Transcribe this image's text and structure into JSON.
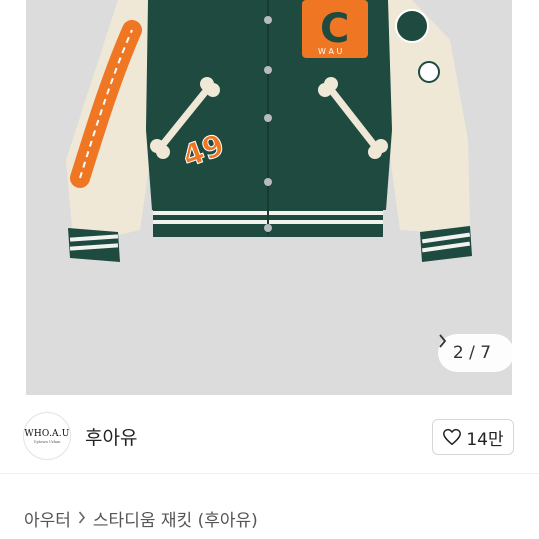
{
  "product_image": {
    "alt": "Varsity jacket photo",
    "counter_current": "2",
    "counter_separator": "/",
    "counter_total": "7",
    "patch_number": "49",
    "patch_letter": "C",
    "patch_sub": "W A U",
    "jacket_colors": {
      "body": "#1e4a3f",
      "sleeve": "#efe8d6",
      "accent": "#ef7622"
    }
  },
  "brand": {
    "logo_text": "WHO.A.U",
    "logo_subtext": "Uptown Urban",
    "name": "후아유"
  },
  "like_button": {
    "count": "14만"
  },
  "breadcrumb": {
    "category": "아우터",
    "product": "스타디움 재킷 (후아유)"
  }
}
